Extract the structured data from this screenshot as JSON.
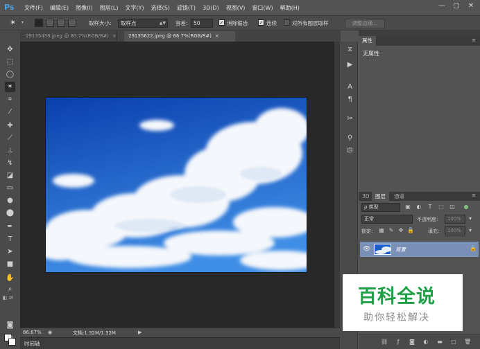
{
  "app": {
    "logo": "Ps"
  },
  "menu": [
    "文件(F)",
    "编辑(E)",
    "图像(I)",
    "图层(L)",
    "文字(Y)",
    "选择(S)",
    "滤镜(T)",
    "3D(D)",
    "视图(V)",
    "窗口(W)",
    "帮助(H)"
  ],
  "window_controls": {
    "minimize": "—",
    "restore": "▢",
    "close": "✕"
  },
  "options": {
    "sample_size_label": "取样大小:",
    "sample_size_value": "取样点",
    "tolerance_label": "容差:",
    "tolerance_value": "50",
    "anti_alias_label": "消除锯齿",
    "anti_alias_checked": true,
    "contiguous_label": "连续",
    "contiguous_checked": true,
    "sample_all_layers_label": "对所有图层取样",
    "sample_all_layers_checked": false,
    "refine_edge_label": "调整边缘..."
  },
  "document_tabs": [
    {
      "label": "29135459.jpeg @ 80.7%(RGB/8#)",
      "active": false
    },
    {
      "label": "29135622.jpeg @ 66.7%(RGB/8#)",
      "active": true
    }
  ],
  "tools": [
    "move-tool",
    "marquee-tool",
    "lasso-tool",
    "magic-wand-tool",
    "crop-tool",
    "eyedropper-tool",
    "healing-tool",
    "brush-tool",
    "clone-stamp-tool",
    "history-brush-tool",
    "eraser-tool",
    "gradient-tool",
    "blur-tool",
    "dodge-tool",
    "pen-tool",
    "type-tool",
    "path-select-tool",
    "shape-tool",
    "hand-tool",
    "zoom-tool"
  ],
  "status": {
    "zoom": "66.67%",
    "doc_info": "文档:1.32M/1.32M"
  },
  "timeline": {
    "label": "时间轴"
  },
  "properties": {
    "tab": "属性",
    "empty_text": "无属性"
  },
  "layers": {
    "tabs": [
      "3D",
      "图层",
      "通道"
    ],
    "filter_label": "ρ 类型",
    "blend_mode": "正常",
    "opacity_label": "不透明度:",
    "opacity_value": "100%",
    "lock_label": "锁定:",
    "fill_label": "填充:",
    "fill_value": "100%",
    "layer_name": "背景"
  },
  "watermark": {
    "title": "百科全说",
    "subtitle": "助你轻松解决"
  },
  "colors": {
    "foreground": "#ffffff",
    "background": "#ffffff",
    "sky_top": "#0a3fae",
    "sky_bottom": "#3f8ee6",
    "watermark_green": "#1fa047"
  }
}
